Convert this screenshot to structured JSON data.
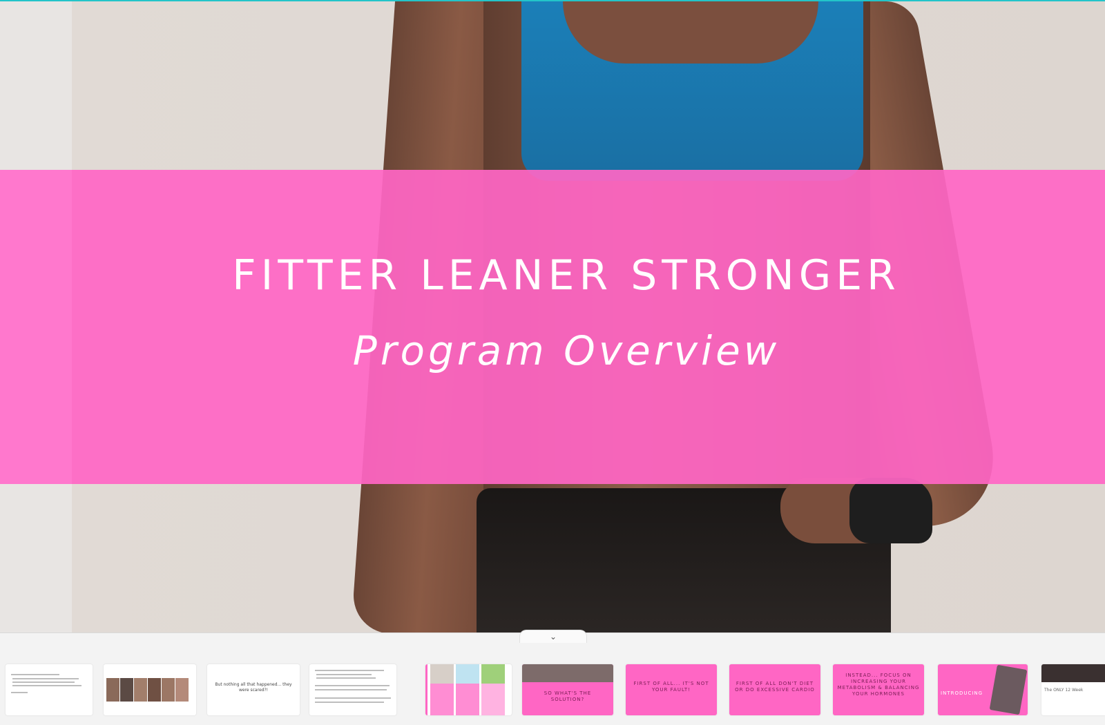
{
  "slide": {
    "title": "FITTER LEANER STRONGER",
    "subtitle": "Program Overview"
  },
  "filmstrip": {
    "collapse_icon": "chevron-down-icon",
    "thumbnails": [
      {
        "id": 1,
        "style": "white-text",
        "caption": ""
      },
      {
        "id": 2,
        "style": "white-photos",
        "caption": ""
      },
      {
        "id": 3,
        "style": "white-caption",
        "caption": "But nothing all that happened... they were scared?!"
      },
      {
        "id": 4,
        "style": "white-text",
        "caption": ""
      },
      {
        "id": 5,
        "style": "pink-columns",
        "caption": ""
      },
      {
        "id": 6,
        "style": "pink-photo-top",
        "caption": "SO WHAT'S THE SOLUTION?"
      },
      {
        "id": 7,
        "style": "pink",
        "caption": "FIRST OF ALL... IT'S NOT YOUR FAULT!"
      },
      {
        "id": 8,
        "style": "pink",
        "caption": "FIRST OF ALL DON'T DIET OR DO EXCESSIVE CARDIO"
      },
      {
        "id": 9,
        "style": "pink",
        "caption": "INSTEAD... FOCUS ON INCREASING YOUR METABOLISM & BALANCING YOUR HORMONES"
      },
      {
        "id": 10,
        "style": "pink-intro",
        "caption": "INTRODUCING"
      },
      {
        "id": 11,
        "style": "white-partial",
        "caption": "The ONLY 12 Week"
      }
    ]
  },
  "colors": {
    "accent_pink": "#ff66c4",
    "accent_teal": "#23c4c9"
  }
}
